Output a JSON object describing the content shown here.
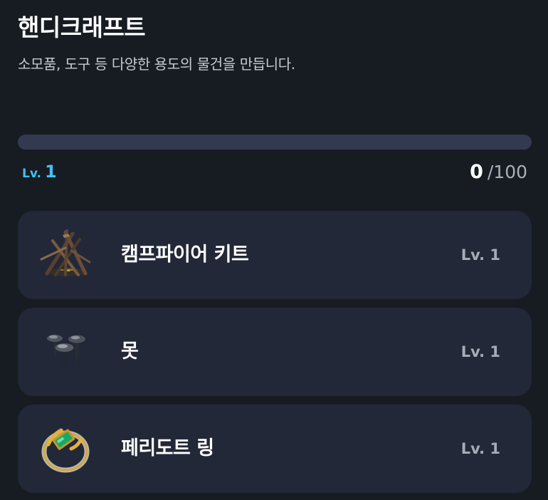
{
  "header": {
    "title": "핸디크래프트",
    "subtitle": "소모품, 도구 등 다양한 용도의 물건을 만듭니다."
  },
  "progress": {
    "level_prefix": "Lv.",
    "level_value": "1",
    "exp_current": "0",
    "exp_max": "/100",
    "fraction": 0,
    "track_color": "#333a50",
    "accent_color": "#3fc3f0"
  },
  "recipes": [
    {
      "name": "캠프파이어 키트",
      "level": "Lv. 1",
      "icon": "campfire-kit-icon"
    },
    {
      "name": "못",
      "level": "Lv. 1",
      "icon": "nails-icon"
    },
    {
      "name": "페리도트 링",
      "level": "Lv. 1",
      "icon": "peridot-ring-icon"
    }
  ]
}
